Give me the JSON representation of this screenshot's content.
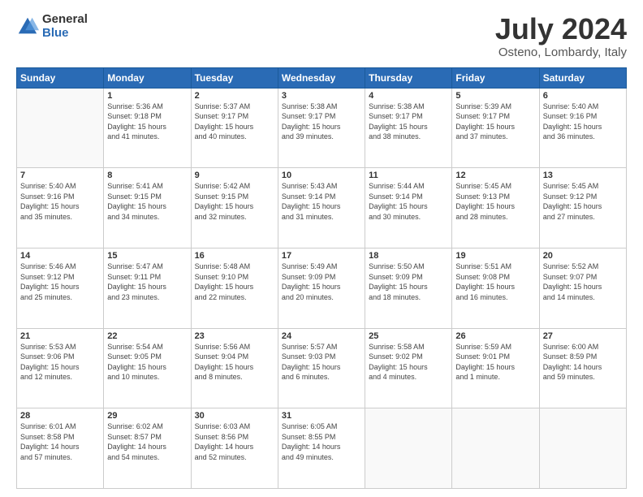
{
  "logo": {
    "general": "General",
    "blue": "Blue"
  },
  "title": {
    "month_year": "July 2024",
    "location": "Osteno, Lombardy, Italy"
  },
  "weekdays": [
    "Sunday",
    "Monday",
    "Tuesday",
    "Wednesday",
    "Thursday",
    "Friday",
    "Saturday"
  ],
  "weeks": [
    [
      {
        "day": "",
        "content": ""
      },
      {
        "day": "1",
        "content": "Sunrise: 5:36 AM\nSunset: 9:18 PM\nDaylight: 15 hours\nand 41 minutes."
      },
      {
        "day": "2",
        "content": "Sunrise: 5:37 AM\nSunset: 9:17 PM\nDaylight: 15 hours\nand 40 minutes."
      },
      {
        "day": "3",
        "content": "Sunrise: 5:38 AM\nSunset: 9:17 PM\nDaylight: 15 hours\nand 39 minutes."
      },
      {
        "day": "4",
        "content": "Sunrise: 5:38 AM\nSunset: 9:17 PM\nDaylight: 15 hours\nand 38 minutes."
      },
      {
        "day": "5",
        "content": "Sunrise: 5:39 AM\nSunset: 9:17 PM\nDaylight: 15 hours\nand 37 minutes."
      },
      {
        "day": "6",
        "content": "Sunrise: 5:40 AM\nSunset: 9:16 PM\nDaylight: 15 hours\nand 36 minutes."
      }
    ],
    [
      {
        "day": "7",
        "content": "Sunrise: 5:40 AM\nSunset: 9:16 PM\nDaylight: 15 hours\nand 35 minutes."
      },
      {
        "day": "8",
        "content": "Sunrise: 5:41 AM\nSunset: 9:15 PM\nDaylight: 15 hours\nand 34 minutes."
      },
      {
        "day": "9",
        "content": "Sunrise: 5:42 AM\nSunset: 9:15 PM\nDaylight: 15 hours\nand 32 minutes."
      },
      {
        "day": "10",
        "content": "Sunrise: 5:43 AM\nSunset: 9:14 PM\nDaylight: 15 hours\nand 31 minutes."
      },
      {
        "day": "11",
        "content": "Sunrise: 5:44 AM\nSunset: 9:14 PM\nDaylight: 15 hours\nand 30 minutes."
      },
      {
        "day": "12",
        "content": "Sunrise: 5:45 AM\nSunset: 9:13 PM\nDaylight: 15 hours\nand 28 minutes."
      },
      {
        "day": "13",
        "content": "Sunrise: 5:45 AM\nSunset: 9:12 PM\nDaylight: 15 hours\nand 27 minutes."
      }
    ],
    [
      {
        "day": "14",
        "content": "Sunrise: 5:46 AM\nSunset: 9:12 PM\nDaylight: 15 hours\nand 25 minutes."
      },
      {
        "day": "15",
        "content": "Sunrise: 5:47 AM\nSunset: 9:11 PM\nDaylight: 15 hours\nand 23 minutes."
      },
      {
        "day": "16",
        "content": "Sunrise: 5:48 AM\nSunset: 9:10 PM\nDaylight: 15 hours\nand 22 minutes."
      },
      {
        "day": "17",
        "content": "Sunrise: 5:49 AM\nSunset: 9:09 PM\nDaylight: 15 hours\nand 20 minutes."
      },
      {
        "day": "18",
        "content": "Sunrise: 5:50 AM\nSunset: 9:09 PM\nDaylight: 15 hours\nand 18 minutes."
      },
      {
        "day": "19",
        "content": "Sunrise: 5:51 AM\nSunset: 9:08 PM\nDaylight: 15 hours\nand 16 minutes."
      },
      {
        "day": "20",
        "content": "Sunrise: 5:52 AM\nSunset: 9:07 PM\nDaylight: 15 hours\nand 14 minutes."
      }
    ],
    [
      {
        "day": "21",
        "content": "Sunrise: 5:53 AM\nSunset: 9:06 PM\nDaylight: 15 hours\nand 12 minutes."
      },
      {
        "day": "22",
        "content": "Sunrise: 5:54 AM\nSunset: 9:05 PM\nDaylight: 15 hours\nand 10 minutes."
      },
      {
        "day": "23",
        "content": "Sunrise: 5:56 AM\nSunset: 9:04 PM\nDaylight: 15 hours\nand 8 minutes."
      },
      {
        "day": "24",
        "content": "Sunrise: 5:57 AM\nSunset: 9:03 PM\nDaylight: 15 hours\nand 6 minutes."
      },
      {
        "day": "25",
        "content": "Sunrise: 5:58 AM\nSunset: 9:02 PM\nDaylight: 15 hours\nand 4 minutes."
      },
      {
        "day": "26",
        "content": "Sunrise: 5:59 AM\nSunset: 9:01 PM\nDaylight: 15 hours\nand 1 minute."
      },
      {
        "day": "27",
        "content": "Sunrise: 6:00 AM\nSunset: 8:59 PM\nDaylight: 14 hours\nand 59 minutes."
      }
    ],
    [
      {
        "day": "28",
        "content": "Sunrise: 6:01 AM\nSunset: 8:58 PM\nDaylight: 14 hours\nand 57 minutes."
      },
      {
        "day": "29",
        "content": "Sunrise: 6:02 AM\nSunset: 8:57 PM\nDaylight: 14 hours\nand 54 minutes."
      },
      {
        "day": "30",
        "content": "Sunrise: 6:03 AM\nSunset: 8:56 PM\nDaylight: 14 hours\nand 52 minutes."
      },
      {
        "day": "31",
        "content": "Sunrise: 6:05 AM\nSunset: 8:55 PM\nDaylight: 14 hours\nand 49 minutes."
      },
      {
        "day": "",
        "content": ""
      },
      {
        "day": "",
        "content": ""
      },
      {
        "day": "",
        "content": ""
      }
    ]
  ]
}
